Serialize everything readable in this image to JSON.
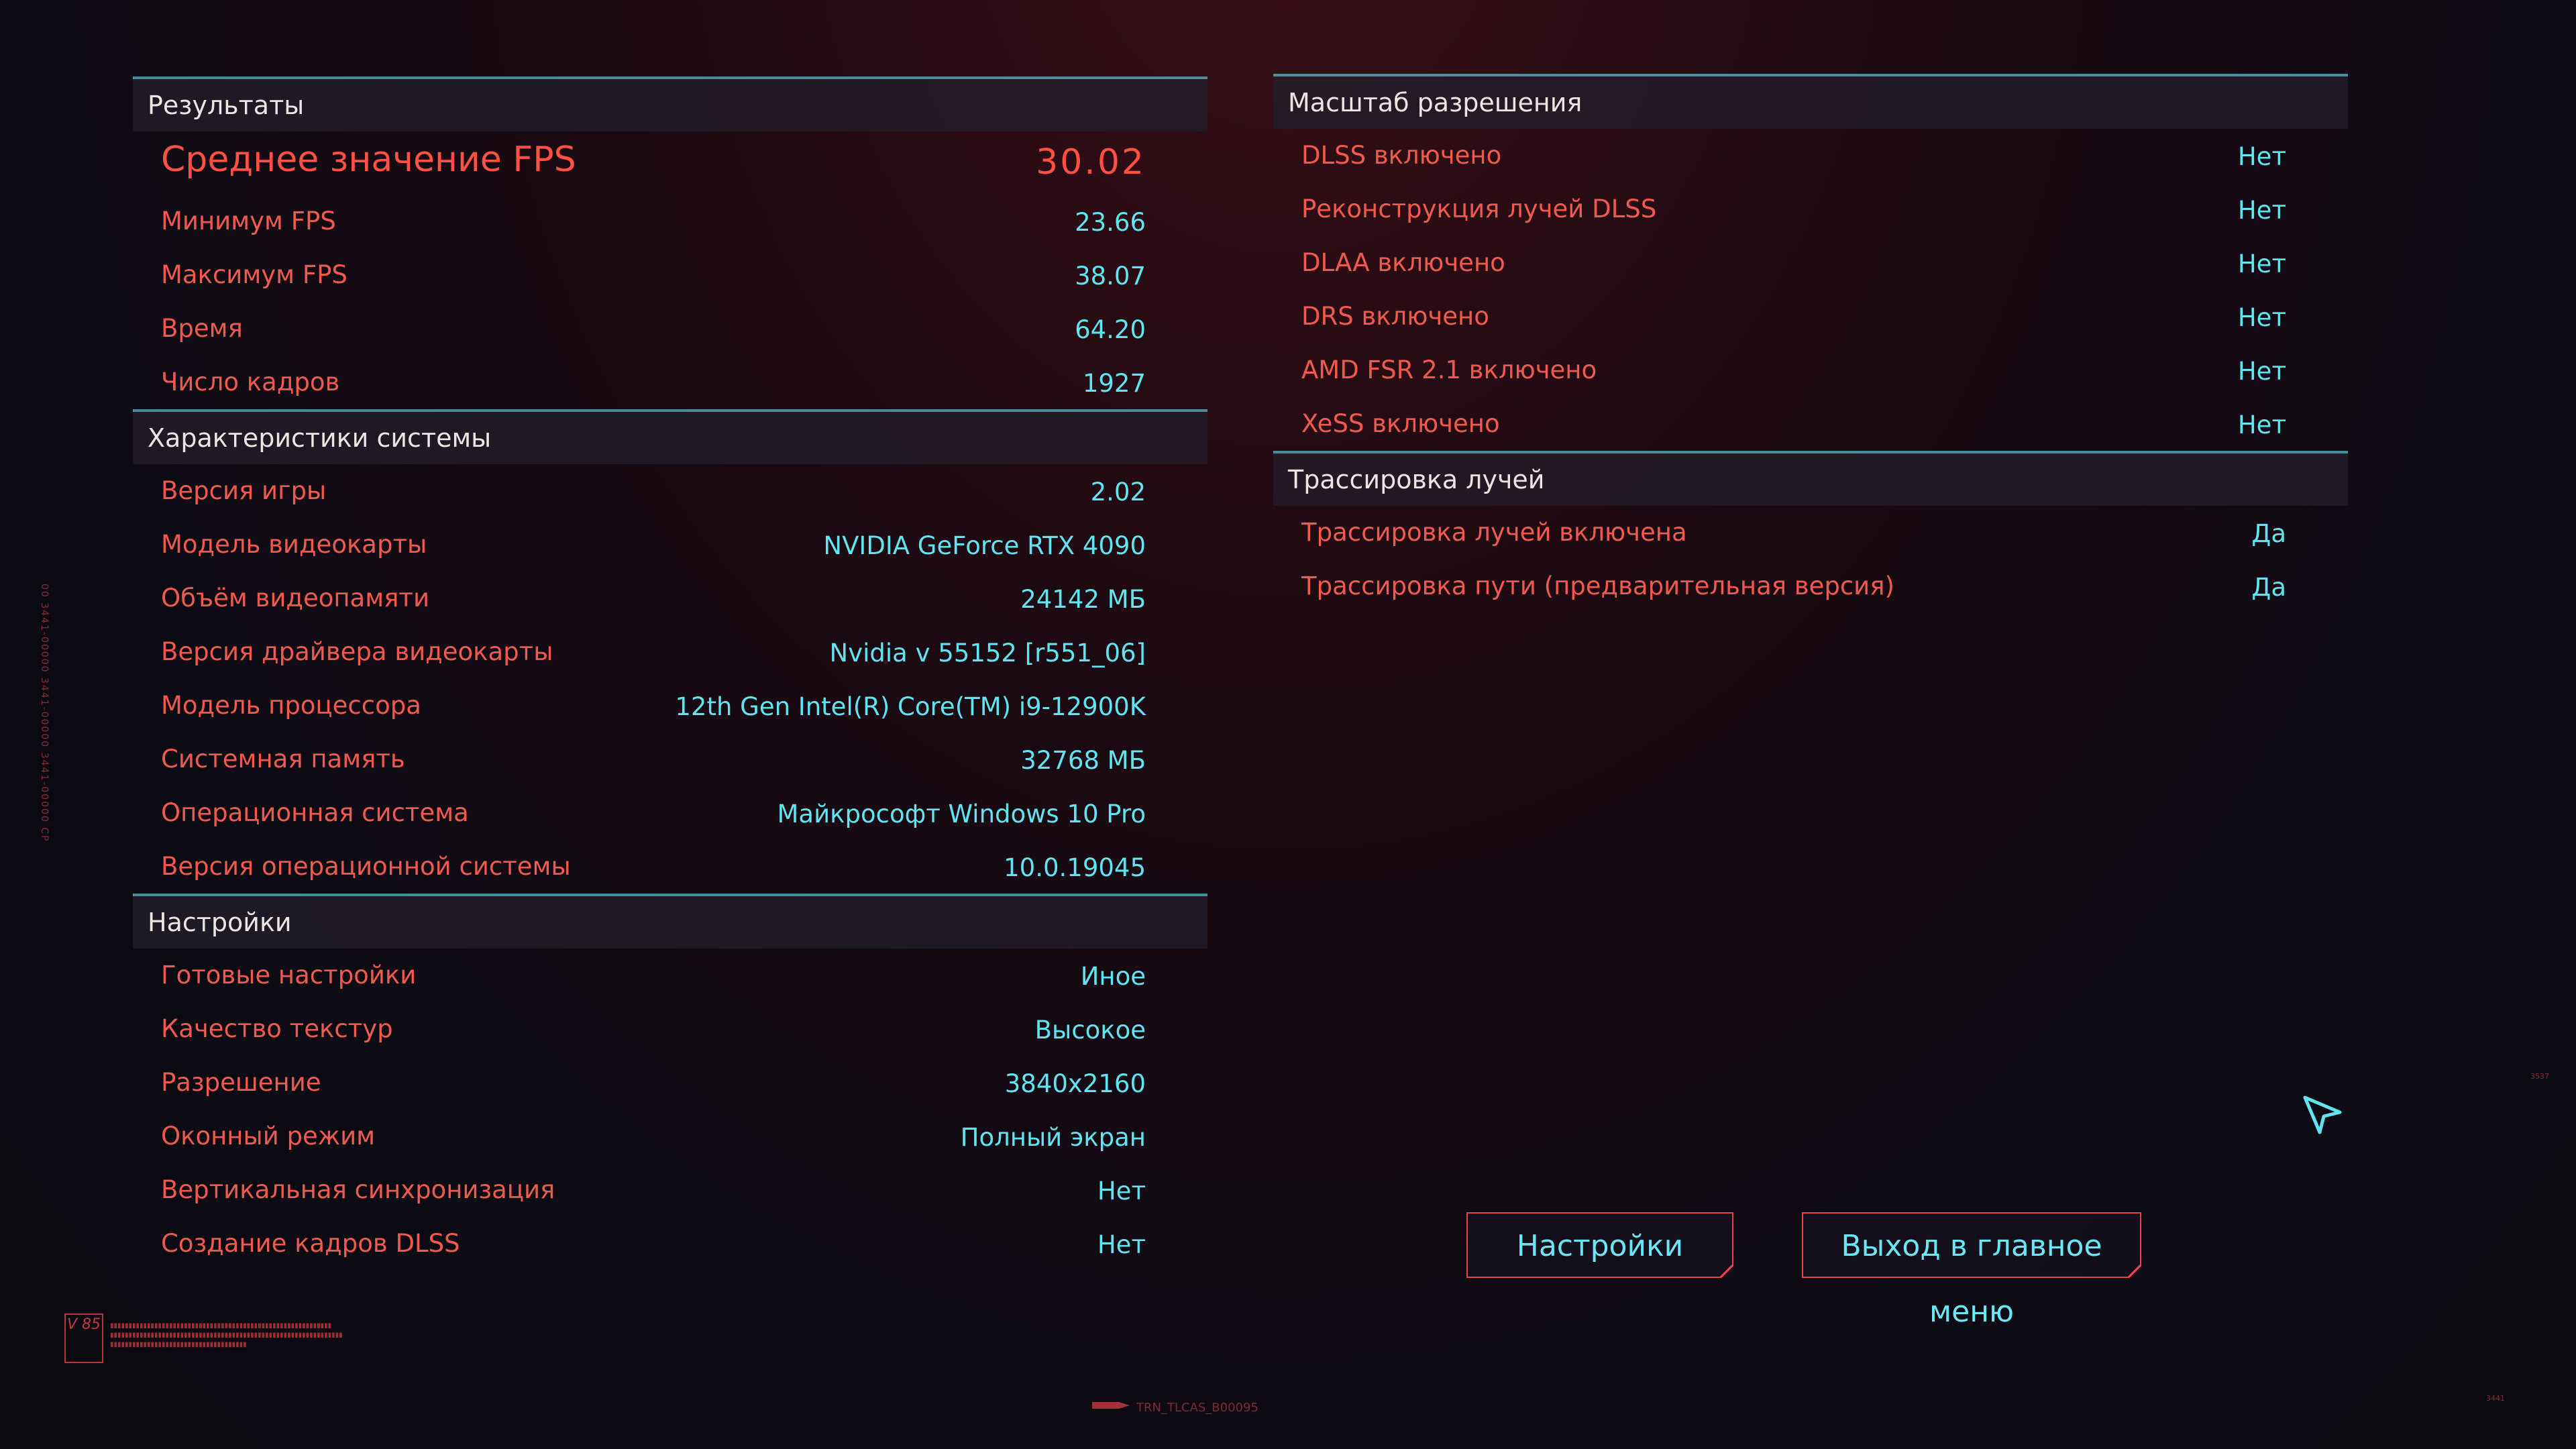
{
  "results": {
    "header": "Результаты",
    "avg_fps": {
      "label": "Среднее значение FPS",
      "value": "30.02"
    },
    "rows": [
      {
        "label": "Минимум FPS",
        "value": "23.66"
      },
      {
        "label": "Максимум FPS",
        "value": "38.07"
      },
      {
        "label": "Время",
        "value": "64.20"
      },
      {
        "label": "Число кадров",
        "value": "1927"
      }
    ]
  },
  "system": {
    "header": "Характеристики системы",
    "rows": [
      {
        "label": "Версия игры",
        "value": "2.02"
      },
      {
        "label": "Модель видеокарты",
        "value": "NVIDIA GeForce RTX 4090"
      },
      {
        "label": "Объём видеопамяти",
        "value": "24142 МБ"
      },
      {
        "label": "Версия драйвера видеокарты",
        "value": "Nvidia v 55152 [r551_06]"
      },
      {
        "label": "Модель процессора",
        "value": "12th Gen Intel(R) Core(TM) i9-12900K"
      },
      {
        "label": "Системная память",
        "value": "32768 МБ"
      },
      {
        "label": "Операционная система",
        "value": "Майкрософт Windows 10 Pro"
      },
      {
        "label": "Версия операционной системы",
        "value": "10.0.19045"
      }
    ]
  },
  "settings": {
    "header": "Настройки",
    "rows": [
      {
        "label": "Готовые настройки",
        "value": "Иное"
      },
      {
        "label": "Качество текстур",
        "value": "Высокое"
      },
      {
        "label": "Разрешение",
        "value": "3840x2160"
      },
      {
        "label": "Оконный режим",
        "value": "Полный экран"
      },
      {
        "label": "Вертикальная синхронизация",
        "value": "Нет"
      },
      {
        "label": "Создание кадров DLSS",
        "value": "Нет"
      }
    ]
  },
  "scaling": {
    "header": "Масштаб разрешения",
    "rows": [
      {
        "label": "DLSS включено",
        "value": "Нет"
      },
      {
        "label": "Реконструкция лучей DLSS",
        "value": "Нет"
      },
      {
        "label": "DLAA включено",
        "value": "Нет"
      },
      {
        "label": "DRS включено",
        "value": "Нет"
      },
      {
        "label": "AMD FSR 2.1 включено",
        "value": "Нет"
      },
      {
        "label": "XeSS включено",
        "value": "Нет"
      }
    ]
  },
  "raytracing": {
    "header": "Трассировка лучей",
    "rows": [
      {
        "label": "Трассировка лучей включена",
        "value": "Да"
      },
      {
        "label": "Трассировка пути (предварительная версия)",
        "value": "Да"
      }
    ]
  },
  "buttons": {
    "settings": "Настройки",
    "exit": "Выход в главное меню"
  },
  "decor": {
    "side_text": "00 3441-00000 3441-00000 3441-00000 CP",
    "badge": "V 85",
    "bottom_tag": "TRN_TLCAS_B00095",
    "corner_top": "3537",
    "corner_bottom": "3441"
  },
  "colors": {
    "label": "#f05a4e",
    "value": "#5fe4f0",
    "accent_rule": "#4fa6b4",
    "button_border": "#e8434a"
  }
}
